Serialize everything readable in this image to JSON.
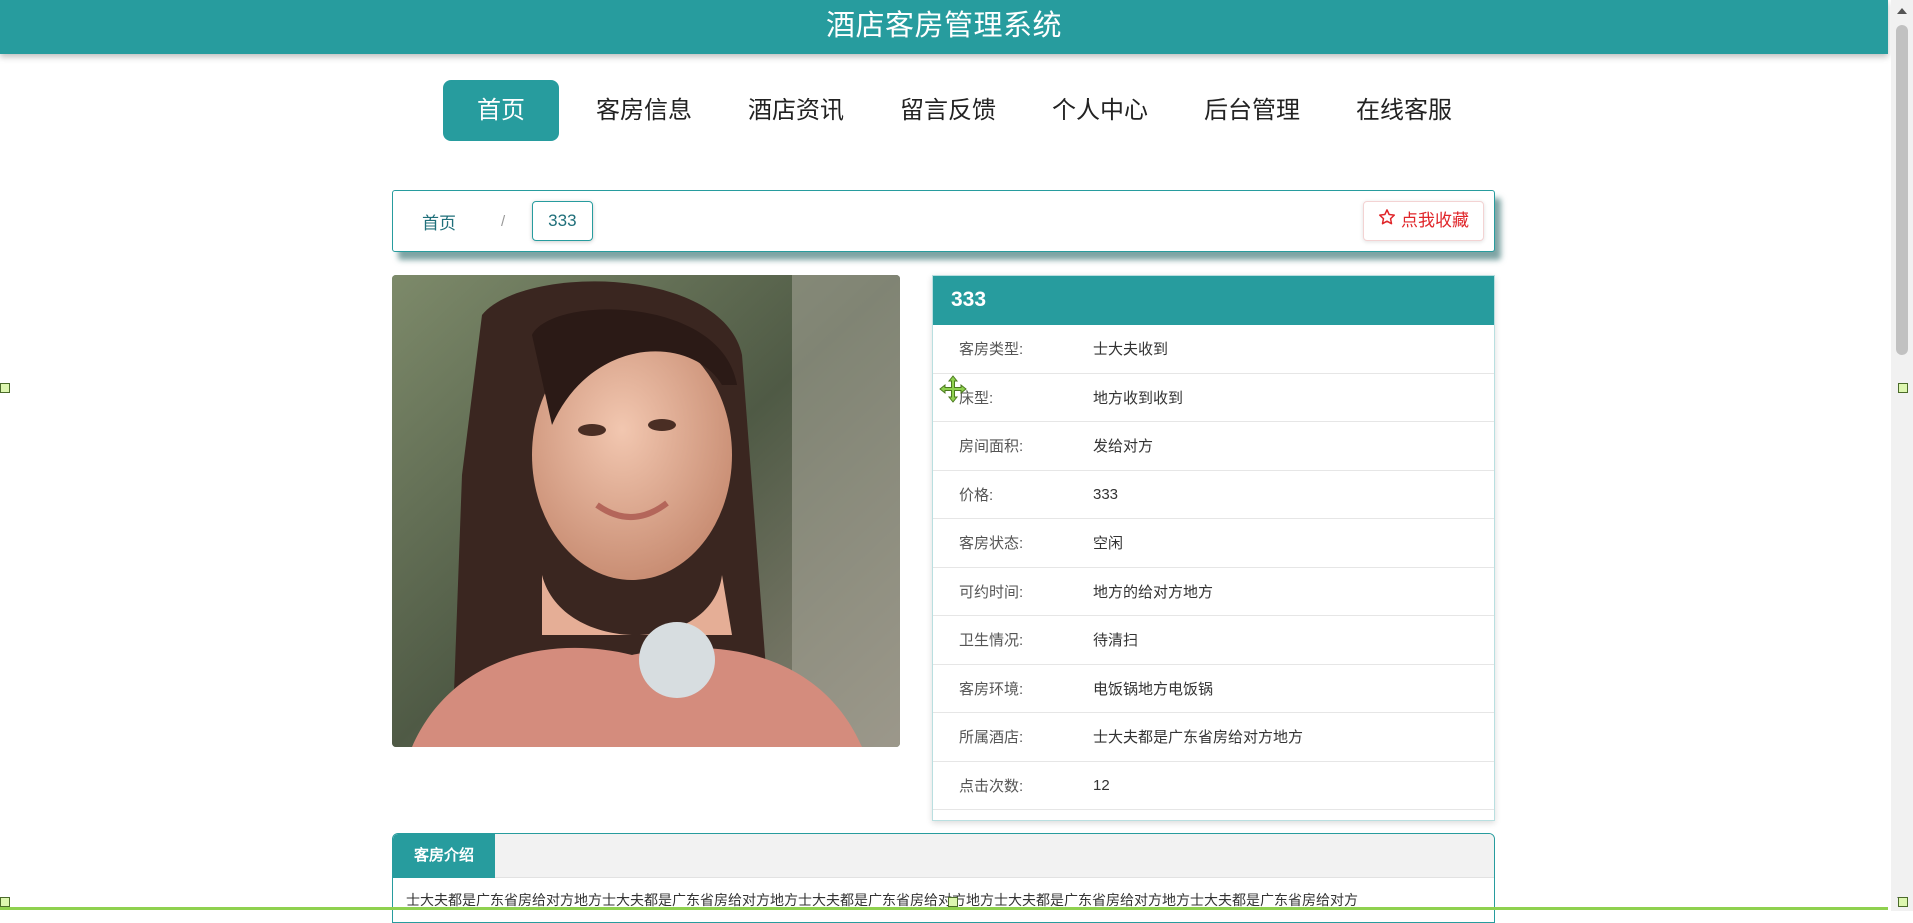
{
  "header": {
    "title": "酒店客房管理系统"
  },
  "nav": [
    {
      "label": "首页",
      "active": true
    },
    {
      "label": "客房信息"
    },
    {
      "label": "酒店资讯"
    },
    {
      "label": "留言反馈"
    },
    {
      "label": "个人中心"
    },
    {
      "label": "后台管理"
    },
    {
      "label": "在线客服"
    }
  ],
  "breadcrumb": {
    "home": "首页",
    "separator": "/",
    "current": "333"
  },
  "favorite": {
    "label": "点我收藏",
    "icon": "star-outline-icon",
    "color": "#e0262a"
  },
  "detail": {
    "title": "333",
    "rows": [
      {
        "label": "客房类型:",
        "value": "士大夫收到"
      },
      {
        "label": "床型:",
        "value": "地方收到收到"
      },
      {
        "label": "房间面积:",
        "value": "发给对方"
      },
      {
        "label": "价格:",
        "value": "333"
      },
      {
        "label": "客房状态:",
        "value": "空闲"
      },
      {
        "label": "可约时间:",
        "value": "地方的给对方地方"
      },
      {
        "label": "卫生情况:",
        "value": "待清扫"
      },
      {
        "label": "客房环境:",
        "value": "电饭锅地方电饭锅"
      },
      {
        "label": "所属酒店:",
        "value": "士大夫都是广东省房给对方地方"
      },
      {
        "label": "点击次数:",
        "value": "12"
      }
    ]
  },
  "intro": {
    "tab": "客房介绍",
    "text": "士大夫都是广东省房给对方地方士大夫都是广东省房给对方地方士大夫都是广东省房给对方地方士大夫都是广东省房给对方地方士大夫都是广东省房给对方"
  },
  "theme": {
    "accent": "#279c9e",
    "selection_handle": "#ddf7b0",
    "bottom_line": "#8fd14f"
  }
}
